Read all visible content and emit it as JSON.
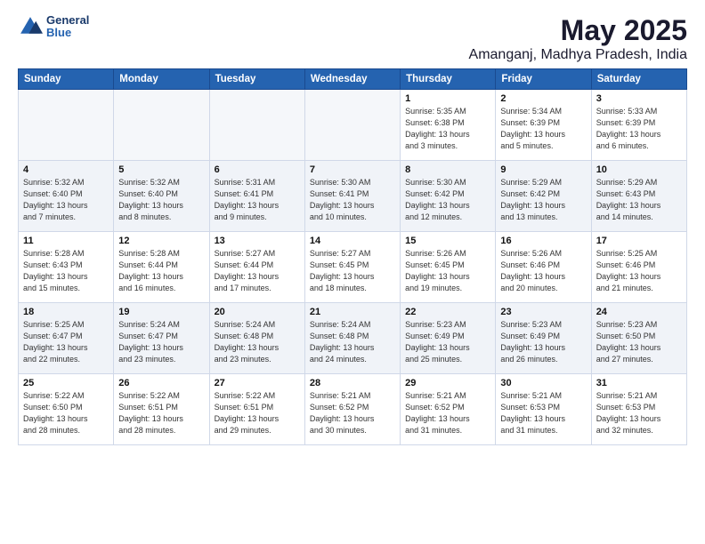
{
  "logo": {
    "line1": "General",
    "line2": "Blue"
  },
  "title": "May 2025",
  "subtitle": "Amanganj, Madhya Pradesh, India",
  "days_of_week": [
    "Sunday",
    "Monday",
    "Tuesday",
    "Wednesday",
    "Thursday",
    "Friday",
    "Saturday"
  ],
  "weeks": [
    [
      {
        "day": "",
        "info": ""
      },
      {
        "day": "",
        "info": ""
      },
      {
        "day": "",
        "info": ""
      },
      {
        "day": "",
        "info": ""
      },
      {
        "day": "1",
        "info": "Sunrise: 5:35 AM\nSunset: 6:38 PM\nDaylight: 13 hours\nand 3 minutes."
      },
      {
        "day": "2",
        "info": "Sunrise: 5:34 AM\nSunset: 6:39 PM\nDaylight: 13 hours\nand 5 minutes."
      },
      {
        "day": "3",
        "info": "Sunrise: 5:33 AM\nSunset: 6:39 PM\nDaylight: 13 hours\nand 6 minutes."
      }
    ],
    [
      {
        "day": "4",
        "info": "Sunrise: 5:32 AM\nSunset: 6:40 PM\nDaylight: 13 hours\nand 7 minutes."
      },
      {
        "day": "5",
        "info": "Sunrise: 5:32 AM\nSunset: 6:40 PM\nDaylight: 13 hours\nand 8 minutes."
      },
      {
        "day": "6",
        "info": "Sunrise: 5:31 AM\nSunset: 6:41 PM\nDaylight: 13 hours\nand 9 minutes."
      },
      {
        "day": "7",
        "info": "Sunrise: 5:30 AM\nSunset: 6:41 PM\nDaylight: 13 hours\nand 10 minutes."
      },
      {
        "day": "8",
        "info": "Sunrise: 5:30 AM\nSunset: 6:42 PM\nDaylight: 13 hours\nand 12 minutes."
      },
      {
        "day": "9",
        "info": "Sunrise: 5:29 AM\nSunset: 6:42 PM\nDaylight: 13 hours\nand 13 minutes."
      },
      {
        "day": "10",
        "info": "Sunrise: 5:29 AM\nSunset: 6:43 PM\nDaylight: 13 hours\nand 14 minutes."
      }
    ],
    [
      {
        "day": "11",
        "info": "Sunrise: 5:28 AM\nSunset: 6:43 PM\nDaylight: 13 hours\nand 15 minutes."
      },
      {
        "day": "12",
        "info": "Sunrise: 5:28 AM\nSunset: 6:44 PM\nDaylight: 13 hours\nand 16 minutes."
      },
      {
        "day": "13",
        "info": "Sunrise: 5:27 AM\nSunset: 6:44 PM\nDaylight: 13 hours\nand 17 minutes."
      },
      {
        "day": "14",
        "info": "Sunrise: 5:27 AM\nSunset: 6:45 PM\nDaylight: 13 hours\nand 18 minutes."
      },
      {
        "day": "15",
        "info": "Sunrise: 5:26 AM\nSunset: 6:45 PM\nDaylight: 13 hours\nand 19 minutes."
      },
      {
        "day": "16",
        "info": "Sunrise: 5:26 AM\nSunset: 6:46 PM\nDaylight: 13 hours\nand 20 minutes."
      },
      {
        "day": "17",
        "info": "Sunrise: 5:25 AM\nSunset: 6:46 PM\nDaylight: 13 hours\nand 21 minutes."
      }
    ],
    [
      {
        "day": "18",
        "info": "Sunrise: 5:25 AM\nSunset: 6:47 PM\nDaylight: 13 hours\nand 22 minutes."
      },
      {
        "day": "19",
        "info": "Sunrise: 5:24 AM\nSunset: 6:47 PM\nDaylight: 13 hours\nand 23 minutes."
      },
      {
        "day": "20",
        "info": "Sunrise: 5:24 AM\nSunset: 6:48 PM\nDaylight: 13 hours\nand 23 minutes."
      },
      {
        "day": "21",
        "info": "Sunrise: 5:24 AM\nSunset: 6:48 PM\nDaylight: 13 hours\nand 24 minutes."
      },
      {
        "day": "22",
        "info": "Sunrise: 5:23 AM\nSunset: 6:49 PM\nDaylight: 13 hours\nand 25 minutes."
      },
      {
        "day": "23",
        "info": "Sunrise: 5:23 AM\nSunset: 6:49 PM\nDaylight: 13 hours\nand 26 minutes."
      },
      {
        "day": "24",
        "info": "Sunrise: 5:23 AM\nSunset: 6:50 PM\nDaylight: 13 hours\nand 27 minutes."
      }
    ],
    [
      {
        "day": "25",
        "info": "Sunrise: 5:22 AM\nSunset: 6:50 PM\nDaylight: 13 hours\nand 28 minutes."
      },
      {
        "day": "26",
        "info": "Sunrise: 5:22 AM\nSunset: 6:51 PM\nDaylight: 13 hours\nand 28 minutes."
      },
      {
        "day": "27",
        "info": "Sunrise: 5:22 AM\nSunset: 6:51 PM\nDaylight: 13 hours\nand 29 minutes."
      },
      {
        "day": "28",
        "info": "Sunrise: 5:21 AM\nSunset: 6:52 PM\nDaylight: 13 hours\nand 30 minutes."
      },
      {
        "day": "29",
        "info": "Sunrise: 5:21 AM\nSunset: 6:52 PM\nDaylight: 13 hours\nand 31 minutes."
      },
      {
        "day": "30",
        "info": "Sunrise: 5:21 AM\nSunset: 6:53 PM\nDaylight: 13 hours\nand 31 minutes."
      },
      {
        "day": "31",
        "info": "Sunrise: 5:21 AM\nSunset: 6:53 PM\nDaylight: 13 hours\nand 32 minutes."
      }
    ]
  ]
}
